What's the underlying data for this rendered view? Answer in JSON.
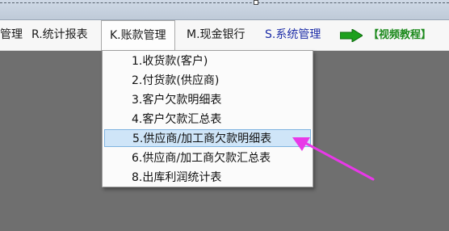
{
  "menubar": {
    "items": [
      {
        "label": "管理"
      },
      {
        "label": "R.统计报表"
      },
      {
        "label": "K.账款管理"
      },
      {
        "label": "M.现金银行"
      },
      {
        "label": "S.系统管理"
      }
    ],
    "video_label": "【视频教程】"
  },
  "dropdown": {
    "items": [
      {
        "label": "1.收货款(客户)"
      },
      {
        "label": "2.付货款(供应商)"
      },
      {
        "label": "3.客户欠款明细表"
      },
      {
        "label": "4.客户欠款汇总表"
      },
      {
        "label": "5.供应商/加工商欠款明细表"
      },
      {
        "label": "6.供应商/加工商欠款汇总表"
      },
      {
        "label": "8.出库利润统计表"
      }
    ]
  },
  "colors": {
    "annotation_arrow": "#e838e8",
    "video_label": "#1d8a1d",
    "system_menu": "#1e2ea8",
    "highlight": "#cfe5f8"
  },
  "icons": {
    "video_arrow": "green-right-arrow-icon",
    "pointer": "magenta-annotation-arrow"
  }
}
